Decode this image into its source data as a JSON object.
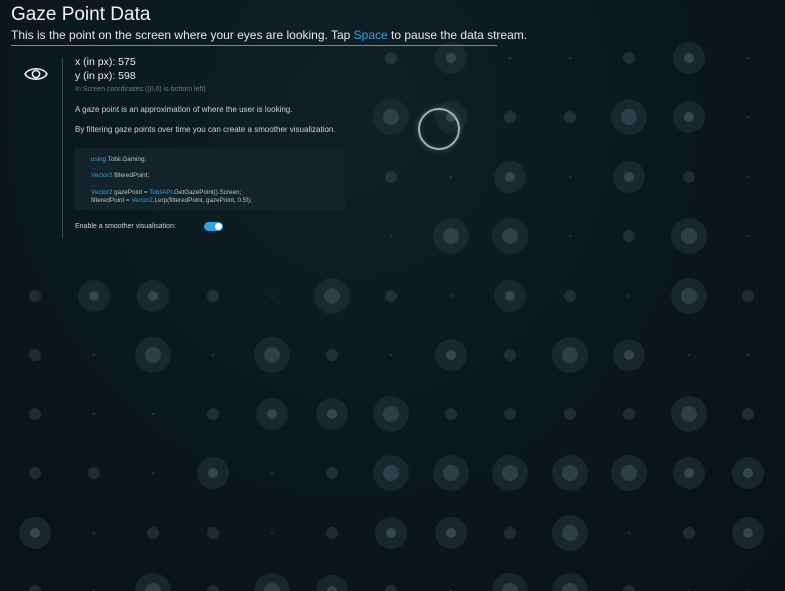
{
  "header": {
    "title": "Gaze Point Data",
    "subtitle_before": "This is the point on the screen where your eyes are looking. Tap ",
    "subtitle_key": "Space",
    "subtitle_after": " to pause the data stream."
  },
  "icon": "eye-icon",
  "gaze": {
    "x_label": "x (in px): 575",
    "y_label": "y (in px): 598",
    "note": "In Screen coordinates ((0,0) is bottom left)"
  },
  "description": {
    "line1": "A gaze point is an approximation of where the user is looking.",
    "line2": "By filtering gaze points over time you can create a smoother visualization."
  },
  "code": {
    "line1_kw": "using",
    "line1_rest": " Tobii.Gaming;",
    "line2": "...",
    "line3_kw": "Vector2",
    "line3_rest": " filteredPoint;",
    "line4": "...",
    "line5_kw": "Vector2",
    "line5_mid": " gazePoint = ",
    "line5_kw2": "TobiiAPI",
    "line5_rest": ".GetGazePoint().Screen;",
    "line6_a": "filteredPoint = ",
    "line6_kw": "Vector2",
    "line6_rest": ".Lerp(filteredPoint, gazePoint, 0.5f);"
  },
  "toggle": {
    "label": "Enable a smoother visualisation:",
    "on": true
  },
  "colors": {
    "accent": "#2fa3e6",
    "background": "#0b171c"
  }
}
